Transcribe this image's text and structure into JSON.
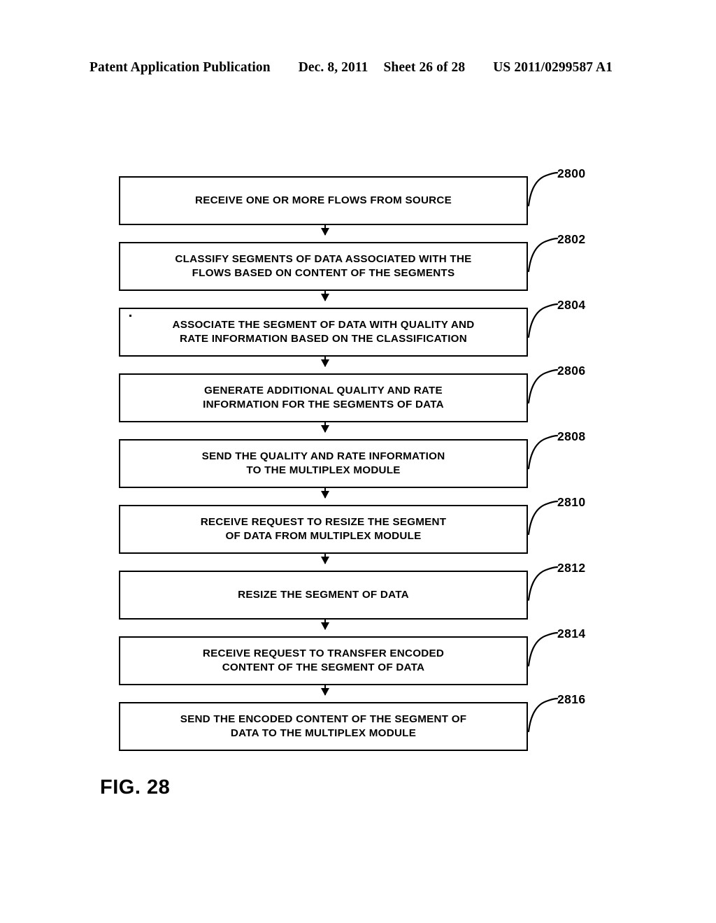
{
  "header": {
    "publication": "Patent Application Publication",
    "date": "Dec. 8, 2011",
    "sheet": "Sheet 26 of 28",
    "patent_number": "US 2011/0299587 A1"
  },
  "figure": {
    "caption": "FIG. 28",
    "type": "flowchart",
    "line_color": "#000000",
    "background_color": "#ffffff"
  },
  "flowchart": {
    "steps": [
      {
        "ref": "2800",
        "text": "RECEIVE ONE OR MORE FLOWS FROM SOURCE"
      },
      {
        "ref": "2802",
        "text": "CLASSIFY SEGMENTS OF DATA ASSOCIATED WITH THE\nFLOWS BASED ON CONTENT OF THE SEGMENTS"
      },
      {
        "ref": "2804",
        "text": "ASSOCIATE THE SEGMENT OF DATA WITH QUALITY AND\nRATE INFORMATION BASED ON THE CLASSIFICATION"
      },
      {
        "ref": "2806",
        "text": "GENERATE ADDITIONAL QUALITY AND RATE\nINFORMATION FOR THE SEGMENTS OF DATA"
      },
      {
        "ref": "2808",
        "text": "SEND THE QUALITY AND RATE INFORMATION\nTO THE MULTIPLEX MODULE"
      },
      {
        "ref": "2810",
        "text": "RECEIVE REQUEST TO RESIZE THE SEGMENT\nOF DATA FROM MULTIPLEX MODULE"
      },
      {
        "ref": "2812",
        "text": "RESIZE THE SEGMENT OF DATA"
      },
      {
        "ref": "2814",
        "text": "RECEIVE REQUEST TO TRANSFER ENCODED\nCONTENT OF THE SEGMENT OF DATA"
      },
      {
        "ref": "2816",
        "text": "SEND THE ENCODED CONTENT OF THE SEGMENT OF\nDATA TO THE MULTIPLEX MODULE"
      }
    ]
  }
}
